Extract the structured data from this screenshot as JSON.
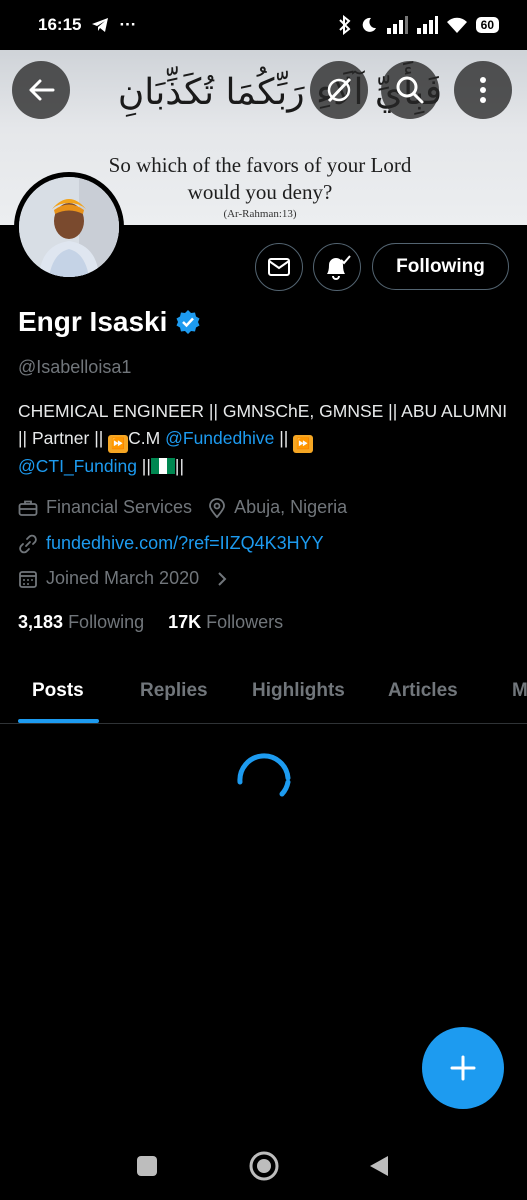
{
  "status_bar": {
    "time": "16:15",
    "more": "···",
    "battery": "60"
  },
  "banner": {
    "arabic": "فَبِأَيِّ آلَاءِ رَبِّكُمَا تُكَذِّبَانِ",
    "line1": "So which of the favors of your Lord",
    "line2": "would you deny?",
    "reference": "(Ar-Rahman:13)"
  },
  "header_buttons": {
    "back": "back-arrow-icon",
    "grok": "grok-icon",
    "search": "search-icon",
    "more": "more-vertical-icon"
  },
  "actions": {
    "following_label": "Following"
  },
  "profile": {
    "name": "Engr Isaski",
    "handle": "@Isabelloisa1",
    "bio_part1": "CHEMICAL ENGINEER || GMNSChE, GMNSE || ABU ALUMNI || Partner || ",
    "bio_part2": "C.M ",
    "bio_link1": "@Fundedhive",
    "bio_part3": " || ",
    "bio_link2": "@CTI_Funding",
    "bio_part4": " ||",
    "bio_part5": "||",
    "category": "Financial Services",
    "location": "Abuja, Nigeria",
    "website": "fundedhive.com/?ref=IIZQ4K3HYY",
    "joined": "Joined March 2020"
  },
  "stats": {
    "following_count": "3,183",
    "following_label": "Following",
    "followers_count": "17K",
    "followers_label": "Followers"
  },
  "tabs": [
    {
      "label": "Posts"
    },
    {
      "label": "Replies"
    },
    {
      "label": "Highlights"
    },
    {
      "label": "Articles"
    },
    {
      "label": "M"
    }
  ],
  "colors": {
    "accent": "#1d9bf0",
    "background": "#000000",
    "muted_text": "#71767b"
  }
}
